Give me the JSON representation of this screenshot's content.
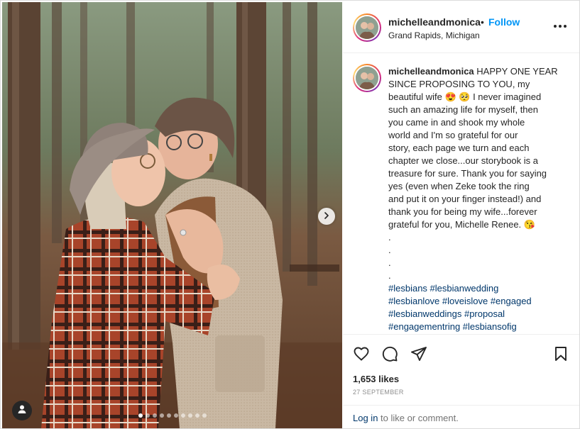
{
  "post": {
    "username": "michelleandmonica",
    "follow_label": "Follow",
    "separator": "•",
    "location": "Grand Rapids, Michigan",
    "media": {
      "slide_count": 10,
      "active_slide": 0
    },
    "caption": {
      "username": "michelleandmonica",
      "lines": [
        "HAPPY ONE YEAR",
        "SINCE PROPOSING TO YOU, my",
        "beautiful wife 😍 🥺 I never imagined",
        "such an amazing life for myself, then",
        "you came in and shook my whole",
        "world and I'm so grateful for our",
        "story, each page we turn and each",
        "chapter we close...our storybook is a",
        "treasure for sure. Thank you for saying",
        "yes (even when Zeke took the ring",
        "and put it on your finger instead!) and",
        "thank you for being my wife...forever",
        "grateful for you, Michelle Renee. 😘",
        ".",
        ".",
        ".",
        "."
      ],
      "hashtag_lines": [
        "#lesbians #lesbianwedding",
        "#lesbianlove #loveislove #engaged",
        "#lesbianweddings #proposal",
        "#engagementring #lesbiansofig"
      ]
    },
    "likes": "1,653 likes",
    "date": "27 SEPTEMBER",
    "footer": {
      "login_link": "Log in",
      "rest": " to like or comment."
    },
    "icons": {
      "more": "more-options-icon",
      "like": "heart-icon",
      "comment": "comment-icon",
      "share": "send-icon",
      "save": "bookmark-icon",
      "next": "chevron-right-icon",
      "tag": "user-tag-icon"
    },
    "colors": {
      "link": "#0095f6",
      "hashtag": "#00376b",
      "muted": "#8e8e8e",
      "text": "#262626"
    }
  }
}
